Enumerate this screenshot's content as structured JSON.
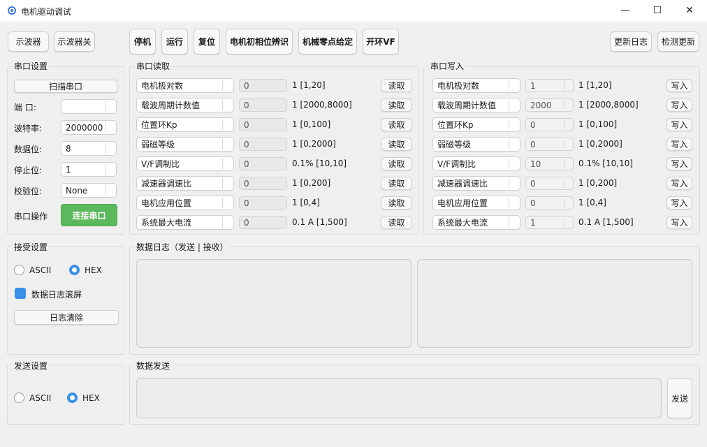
{
  "window": {
    "title": "电机驱动调试",
    "minimize": "—",
    "maximize": "☐",
    "close": "✕"
  },
  "toolbar": {
    "scope_on": "示波器",
    "scope_off": "示波器关",
    "stop": "停机",
    "run": "运行",
    "reset": "复位",
    "phase_identify": "电机初相位辨识",
    "zero_set": "机械零点给定",
    "open_loop_vf": "开环VF",
    "changelog": "更新日志",
    "check_update": "检测更新"
  },
  "serial_settings": {
    "title": "串口设置",
    "scan": "扫描串口",
    "port_label": "端 口:",
    "port_value": "",
    "baud_label": "波特率:",
    "baud_value": "2000000",
    "data_bits_label": "数据位:",
    "data_bits_value": "8",
    "stop_bits_label": "停止位:",
    "stop_bits_value": "1",
    "parity_label": "校验位:",
    "parity_value": "None",
    "op_label": "串口操作",
    "connect": "连接串口"
  },
  "serial_read": {
    "title": "串口读取",
    "button": "读取",
    "rows": [
      {
        "param": "电机极对数",
        "value": "0",
        "range": "1 [1,20]"
      },
      {
        "param": "载波周期计数值",
        "value": "0",
        "range": "1 [2000,8000]"
      },
      {
        "param": "位置环Kp",
        "value": "0",
        "range": "1 [0,100]"
      },
      {
        "param": "弱磁等级",
        "value": "0",
        "range": "1 [0,2000]"
      },
      {
        "param": "V/F调制比",
        "value": "0",
        "range": "0.1% [10,10]"
      },
      {
        "param": "减速器调速比",
        "value": "0",
        "range": "1 [0,200]"
      },
      {
        "param": "电机应用位置",
        "value": "0",
        "range": "1 [0,4]"
      },
      {
        "param": "系统最大电流",
        "value": "0",
        "range": "0.1 A [1,500]"
      }
    ]
  },
  "serial_write": {
    "title": "串口写入",
    "button": "写入",
    "rows": [
      {
        "param": "电机极对数",
        "value": "1",
        "range": "1 [1,20]"
      },
      {
        "param": "载波周期计数值",
        "value": "2000",
        "range": "1 [2000,8000]"
      },
      {
        "param": "位置环Kp",
        "value": "0",
        "range": "1 [0,100]"
      },
      {
        "param": "弱磁等级",
        "value": "0",
        "range": "1 [0,2000]"
      },
      {
        "param": "V/F调制比",
        "value": "10",
        "range": "0.1% [10,10]"
      },
      {
        "param": "减速器调速比",
        "value": "0",
        "range": "1 [0,200]"
      },
      {
        "param": "电机应用位置",
        "value": "0",
        "range": "1 [0,4]"
      },
      {
        "param": "系统最大电流",
        "value": "1",
        "range": "0.1 A [1,500]"
      }
    ]
  },
  "receive_settings": {
    "title": "接受设置",
    "ascii": "ASCII",
    "hex": "HEX",
    "selected": "HEX",
    "autoscroll": "数据日志滚屏",
    "autoscroll_checked": true,
    "clear": "日志清除"
  },
  "data_log": {
    "title": "数据日志（发送 | 接收）"
  },
  "send_settings": {
    "title": "发送设置",
    "ascii": "ASCII",
    "hex": "HEX",
    "selected": "HEX"
  },
  "data_send": {
    "title": "数据发送",
    "send": "发送"
  },
  "colors": {
    "accent": "#3c8fe8",
    "connect": "#5cb85c"
  },
  "icons": [
    "app-icon",
    "minimize-icon",
    "maximize-icon",
    "close-icon",
    "dropdown-arrow-icon"
  ]
}
